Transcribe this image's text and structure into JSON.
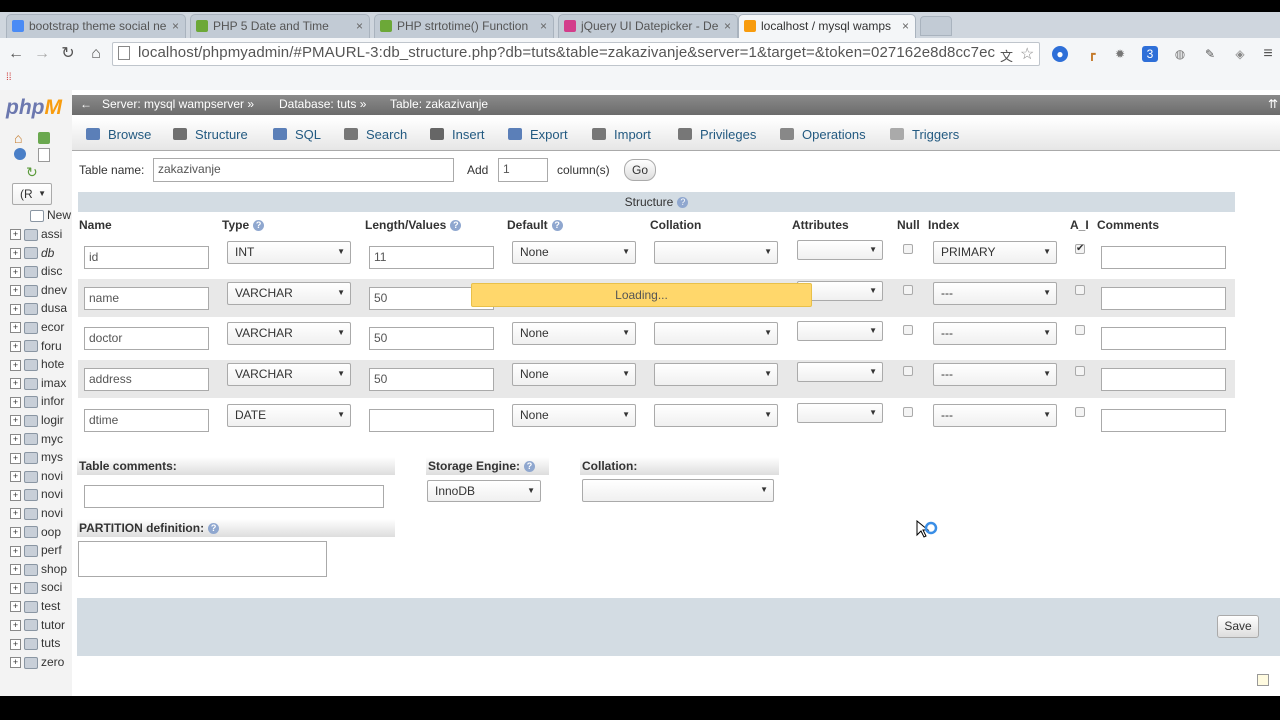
{
  "browser": {
    "tabs": [
      {
        "label": "bootstrap theme social ne",
        "icon_color": "#4a8bf5"
      },
      {
        "label": "PHP 5 Date and Time",
        "icon_color": "#6ca838"
      },
      {
        "label": "PHP strtotime() Function",
        "icon_color": "#6ca838"
      },
      {
        "label": "jQuery UI Datepicker - De",
        "icon_color": "#d33d8b"
      },
      {
        "label": "localhost / mysql wamps",
        "icon_color": "#f89c0e"
      }
    ],
    "url": "localhost/phpmyadmin/#PMAURL-3:db_structure.php?db=tuts&table=zakazivanje&server=1&target=&token=027162e8d8cc7ec"
  },
  "sidebar": {
    "logo_main": "php",
    "logo_accent": "M",
    "server_select": "(R",
    "new_label": "New",
    "databases": [
      "assi",
      "db",
      "disc",
      "dnev",
      "dusa",
      "ecor",
      "foru",
      "hote",
      "imax",
      "infor",
      "logir",
      "myc",
      "mys",
      "novi",
      "novi",
      "novi",
      "oop",
      "perf",
      "shop",
      "soci",
      "test",
      "tutor",
      "tuts",
      "zero"
    ]
  },
  "breadcrumb": {
    "server": "Server: mysql wampserver »",
    "database": "Database: tuts »",
    "table": "Table: zakazivanje"
  },
  "menu": [
    "Browse",
    "Structure",
    "SQL",
    "Search",
    "Insert",
    "Export",
    "Import",
    "Privileges",
    "Operations",
    "Triggers"
  ],
  "form": {
    "table_name_label": "Table name:",
    "table_name_value": "zakazivanje",
    "add_label": "Add",
    "add_value": "1",
    "columns_label": "column(s)",
    "go_label": "Go",
    "structure_label": "Structure"
  },
  "columns_header": [
    "Name",
    "Type",
    "Length/Values",
    "Default",
    "Collation",
    "Attributes",
    "Null",
    "Index",
    "A_I",
    "Comments"
  ],
  "fields": [
    {
      "name": "id",
      "type": "INT",
      "length": "11",
      "default": "None",
      "collation": "",
      "attributes": "",
      "null": false,
      "index": "PRIMARY",
      "ai": true,
      "comment": ""
    },
    {
      "name": "name",
      "type": "VARCHAR",
      "length": "50",
      "default": "",
      "collation": "",
      "attributes": "",
      "null": false,
      "index": "---",
      "ai": false,
      "comment": ""
    },
    {
      "name": "doctor",
      "type": "VARCHAR",
      "length": "50",
      "default": "None",
      "collation": "",
      "attributes": "",
      "null": false,
      "index": "---",
      "ai": false,
      "comment": ""
    },
    {
      "name": "address",
      "type": "VARCHAR",
      "length": "50",
      "default": "None",
      "collation": "",
      "attributes": "",
      "null": false,
      "index": "---",
      "ai": false,
      "comment": ""
    },
    {
      "name": "dtime",
      "type": "DATE",
      "length": "",
      "default": "None",
      "collation": "",
      "attributes": "",
      "null": false,
      "index": "---",
      "ai": false,
      "comment": ""
    }
  ],
  "loading_text": "Loading...",
  "bottom": {
    "table_comments_label": "Table comments:",
    "storage_engine_label": "Storage Engine:",
    "storage_engine_value": "InnoDB",
    "collation_label": "Collation:",
    "partition_label": "PARTITION definition:"
  },
  "save_label": "Save",
  "colors": {
    "link": "#235a81",
    "loading": "#ffd76b",
    "panel": "#d3dce3"
  }
}
